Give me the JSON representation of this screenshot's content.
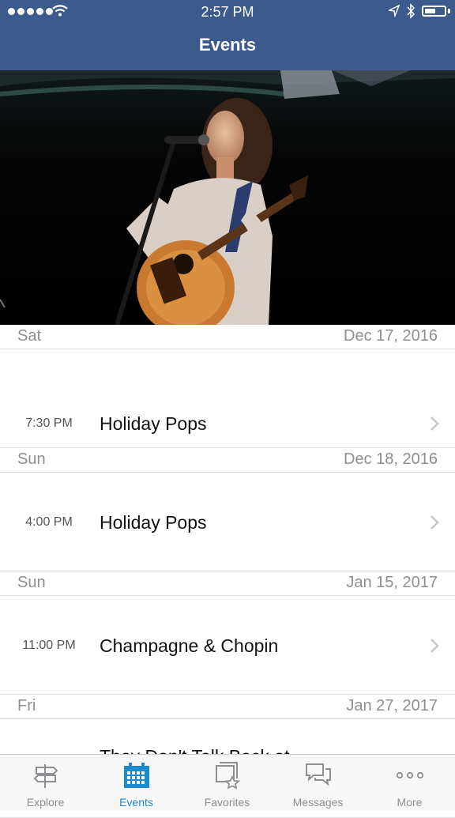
{
  "status_bar": {
    "time": "2:57 PM",
    "battery_level": 0.55
  },
  "nav": {
    "title": "Events"
  },
  "event_groups": [
    {
      "day": "Sat",
      "date": "Dec 17, 2016",
      "events": [
        {
          "time": "7:30 PM",
          "title": "Holiday Pops"
        }
      ]
    },
    {
      "day": "Sun",
      "date": "Dec 18, 2016",
      "events": [
        {
          "time": "4:00 PM",
          "title": "Holiday Pops"
        }
      ]
    },
    {
      "day": "Sun",
      "date": "Jan 15, 2017",
      "events": [
        {
          "time": "11:00 PM",
          "title": "Champagne & Chopin"
        }
      ]
    },
    {
      "day": "Fri",
      "date": "Jan 27, 2017",
      "events": [
        {
          "time": "",
          "title": "They Don't Talk Back at"
        }
      ]
    }
  ],
  "tabs": [
    {
      "label": "Explore",
      "icon": "signpost-icon"
    },
    {
      "label": "Events",
      "icon": "calendar-icon",
      "active": true
    },
    {
      "label": "Favorites",
      "icon": "favorites-icon"
    },
    {
      "label": "Messages",
      "icon": "messages-icon"
    },
    {
      "label": "More",
      "icon": "more-icon"
    }
  ],
  "colors": {
    "nav_bar": "#3d5a8c",
    "active_tab": "#1a8bd0",
    "inactive_tab": "#8e8e93"
  }
}
